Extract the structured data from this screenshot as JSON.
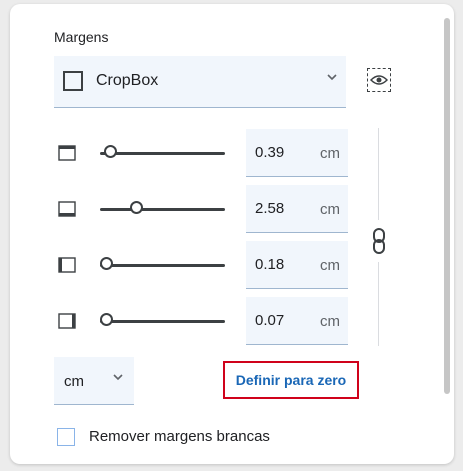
{
  "section": {
    "title": "Margens"
  },
  "preset": {
    "value": "CropBox"
  },
  "margins": [
    {
      "name": "top",
      "value": "0.39",
      "unit": "cm",
      "slider_fraction": 0.04
    },
    {
      "name": "bottom",
      "value": "2.58",
      "unit": "cm",
      "slider_fraction": 0.27
    },
    {
      "name": "left",
      "value": "0.18",
      "unit": "cm",
      "slider_fraction": 0.0
    },
    {
      "name": "right",
      "value": "0.07",
      "unit": "cm",
      "slider_fraction": 0.0
    }
  ],
  "unit_select": {
    "value": "cm"
  },
  "reset_button": {
    "label": "Definir para zero"
  },
  "remove_white_margins": {
    "label": "Remover margens brancas",
    "checked": false
  },
  "colors": {
    "accent": "#1a67b6",
    "highlight_border": "#d0021b",
    "field_bg": "#f1f6fc"
  },
  "icons": [
    "eye-icon",
    "margin-top-icon",
    "margin-bottom-icon",
    "margin-left-icon",
    "margin-right-icon",
    "link-icon",
    "chevron-down-icon"
  ]
}
